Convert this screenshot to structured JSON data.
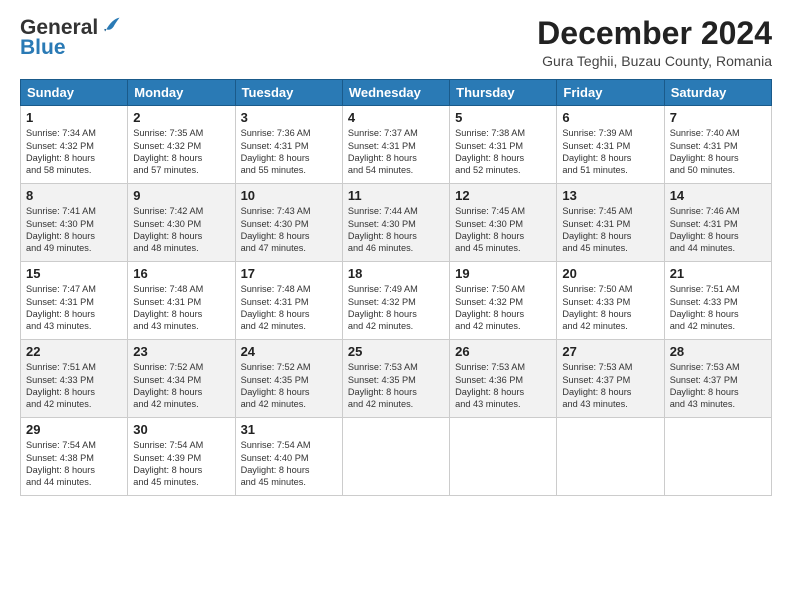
{
  "header": {
    "logo_general": "General",
    "logo_blue": "Blue",
    "month_title": "December 2024",
    "location": "Gura Teghii, Buzau County, Romania"
  },
  "days_of_week": [
    "Sunday",
    "Monday",
    "Tuesday",
    "Wednesday",
    "Thursday",
    "Friday",
    "Saturday"
  ],
  "weeks": [
    [
      {
        "day": 1,
        "sunrise": "Sunrise: 7:34 AM",
        "sunset": "Sunset: 4:32 PM",
        "daylight": "Daylight: 8 hours and 58 minutes."
      },
      {
        "day": 2,
        "sunrise": "Sunrise: 7:35 AM",
        "sunset": "Sunset: 4:32 PM",
        "daylight": "Daylight: 8 hours and 57 minutes."
      },
      {
        "day": 3,
        "sunrise": "Sunrise: 7:36 AM",
        "sunset": "Sunset: 4:31 PM",
        "daylight": "Daylight: 8 hours and 55 minutes."
      },
      {
        "day": 4,
        "sunrise": "Sunrise: 7:37 AM",
        "sunset": "Sunset: 4:31 PM",
        "daylight": "Daylight: 8 hours and 54 minutes."
      },
      {
        "day": 5,
        "sunrise": "Sunrise: 7:38 AM",
        "sunset": "Sunset: 4:31 PM",
        "daylight": "Daylight: 8 hours and 52 minutes."
      },
      {
        "day": 6,
        "sunrise": "Sunrise: 7:39 AM",
        "sunset": "Sunset: 4:31 PM",
        "daylight": "Daylight: 8 hours and 51 minutes."
      },
      {
        "day": 7,
        "sunrise": "Sunrise: 7:40 AM",
        "sunset": "Sunset: 4:31 PM",
        "daylight": "Daylight: 8 hours and 50 minutes."
      }
    ],
    [
      {
        "day": 8,
        "sunrise": "Sunrise: 7:41 AM",
        "sunset": "Sunset: 4:30 PM",
        "daylight": "Daylight: 8 hours and 49 minutes."
      },
      {
        "day": 9,
        "sunrise": "Sunrise: 7:42 AM",
        "sunset": "Sunset: 4:30 PM",
        "daylight": "Daylight: 8 hours and 48 minutes."
      },
      {
        "day": 10,
        "sunrise": "Sunrise: 7:43 AM",
        "sunset": "Sunset: 4:30 PM",
        "daylight": "Daylight: 8 hours and 47 minutes."
      },
      {
        "day": 11,
        "sunrise": "Sunrise: 7:44 AM",
        "sunset": "Sunset: 4:30 PM",
        "daylight": "Daylight: 8 hours and 46 minutes."
      },
      {
        "day": 12,
        "sunrise": "Sunrise: 7:45 AM",
        "sunset": "Sunset: 4:30 PM",
        "daylight": "Daylight: 8 hours and 45 minutes."
      },
      {
        "day": 13,
        "sunrise": "Sunrise: 7:45 AM",
        "sunset": "Sunset: 4:31 PM",
        "daylight": "Daylight: 8 hours and 45 minutes."
      },
      {
        "day": 14,
        "sunrise": "Sunrise: 7:46 AM",
        "sunset": "Sunset: 4:31 PM",
        "daylight": "Daylight: 8 hours and 44 minutes."
      }
    ],
    [
      {
        "day": 15,
        "sunrise": "Sunrise: 7:47 AM",
        "sunset": "Sunset: 4:31 PM",
        "daylight": "Daylight: 8 hours and 43 minutes."
      },
      {
        "day": 16,
        "sunrise": "Sunrise: 7:48 AM",
        "sunset": "Sunset: 4:31 PM",
        "daylight": "Daylight: 8 hours and 43 minutes."
      },
      {
        "day": 17,
        "sunrise": "Sunrise: 7:48 AM",
        "sunset": "Sunset: 4:31 PM",
        "daylight": "Daylight: 8 hours and 42 minutes."
      },
      {
        "day": 18,
        "sunrise": "Sunrise: 7:49 AM",
        "sunset": "Sunset: 4:32 PM",
        "daylight": "Daylight: 8 hours and 42 minutes."
      },
      {
        "day": 19,
        "sunrise": "Sunrise: 7:50 AM",
        "sunset": "Sunset: 4:32 PM",
        "daylight": "Daylight: 8 hours and 42 minutes."
      },
      {
        "day": 20,
        "sunrise": "Sunrise: 7:50 AM",
        "sunset": "Sunset: 4:33 PM",
        "daylight": "Daylight: 8 hours and 42 minutes."
      },
      {
        "day": 21,
        "sunrise": "Sunrise: 7:51 AM",
        "sunset": "Sunset: 4:33 PM",
        "daylight": "Daylight: 8 hours and 42 minutes."
      }
    ],
    [
      {
        "day": 22,
        "sunrise": "Sunrise: 7:51 AM",
        "sunset": "Sunset: 4:33 PM",
        "daylight": "Daylight: 8 hours and 42 minutes."
      },
      {
        "day": 23,
        "sunrise": "Sunrise: 7:52 AM",
        "sunset": "Sunset: 4:34 PM",
        "daylight": "Daylight: 8 hours and 42 minutes."
      },
      {
        "day": 24,
        "sunrise": "Sunrise: 7:52 AM",
        "sunset": "Sunset: 4:35 PM",
        "daylight": "Daylight: 8 hours and 42 minutes."
      },
      {
        "day": 25,
        "sunrise": "Sunrise: 7:53 AM",
        "sunset": "Sunset: 4:35 PM",
        "daylight": "Daylight: 8 hours and 42 minutes."
      },
      {
        "day": 26,
        "sunrise": "Sunrise: 7:53 AM",
        "sunset": "Sunset: 4:36 PM",
        "daylight": "Daylight: 8 hours and 43 minutes."
      },
      {
        "day": 27,
        "sunrise": "Sunrise: 7:53 AM",
        "sunset": "Sunset: 4:37 PM",
        "daylight": "Daylight: 8 hours and 43 minutes."
      },
      {
        "day": 28,
        "sunrise": "Sunrise: 7:53 AM",
        "sunset": "Sunset: 4:37 PM",
        "daylight": "Daylight: 8 hours and 43 minutes."
      }
    ],
    [
      {
        "day": 29,
        "sunrise": "Sunrise: 7:54 AM",
        "sunset": "Sunset: 4:38 PM",
        "daylight": "Daylight: 8 hours and 44 minutes."
      },
      {
        "day": 30,
        "sunrise": "Sunrise: 7:54 AM",
        "sunset": "Sunset: 4:39 PM",
        "daylight": "Daylight: 8 hours and 45 minutes."
      },
      {
        "day": 31,
        "sunrise": "Sunrise: 7:54 AM",
        "sunset": "Sunset: 4:40 PM",
        "daylight": "Daylight: 8 hours and 45 minutes."
      },
      null,
      null,
      null,
      null
    ]
  ]
}
